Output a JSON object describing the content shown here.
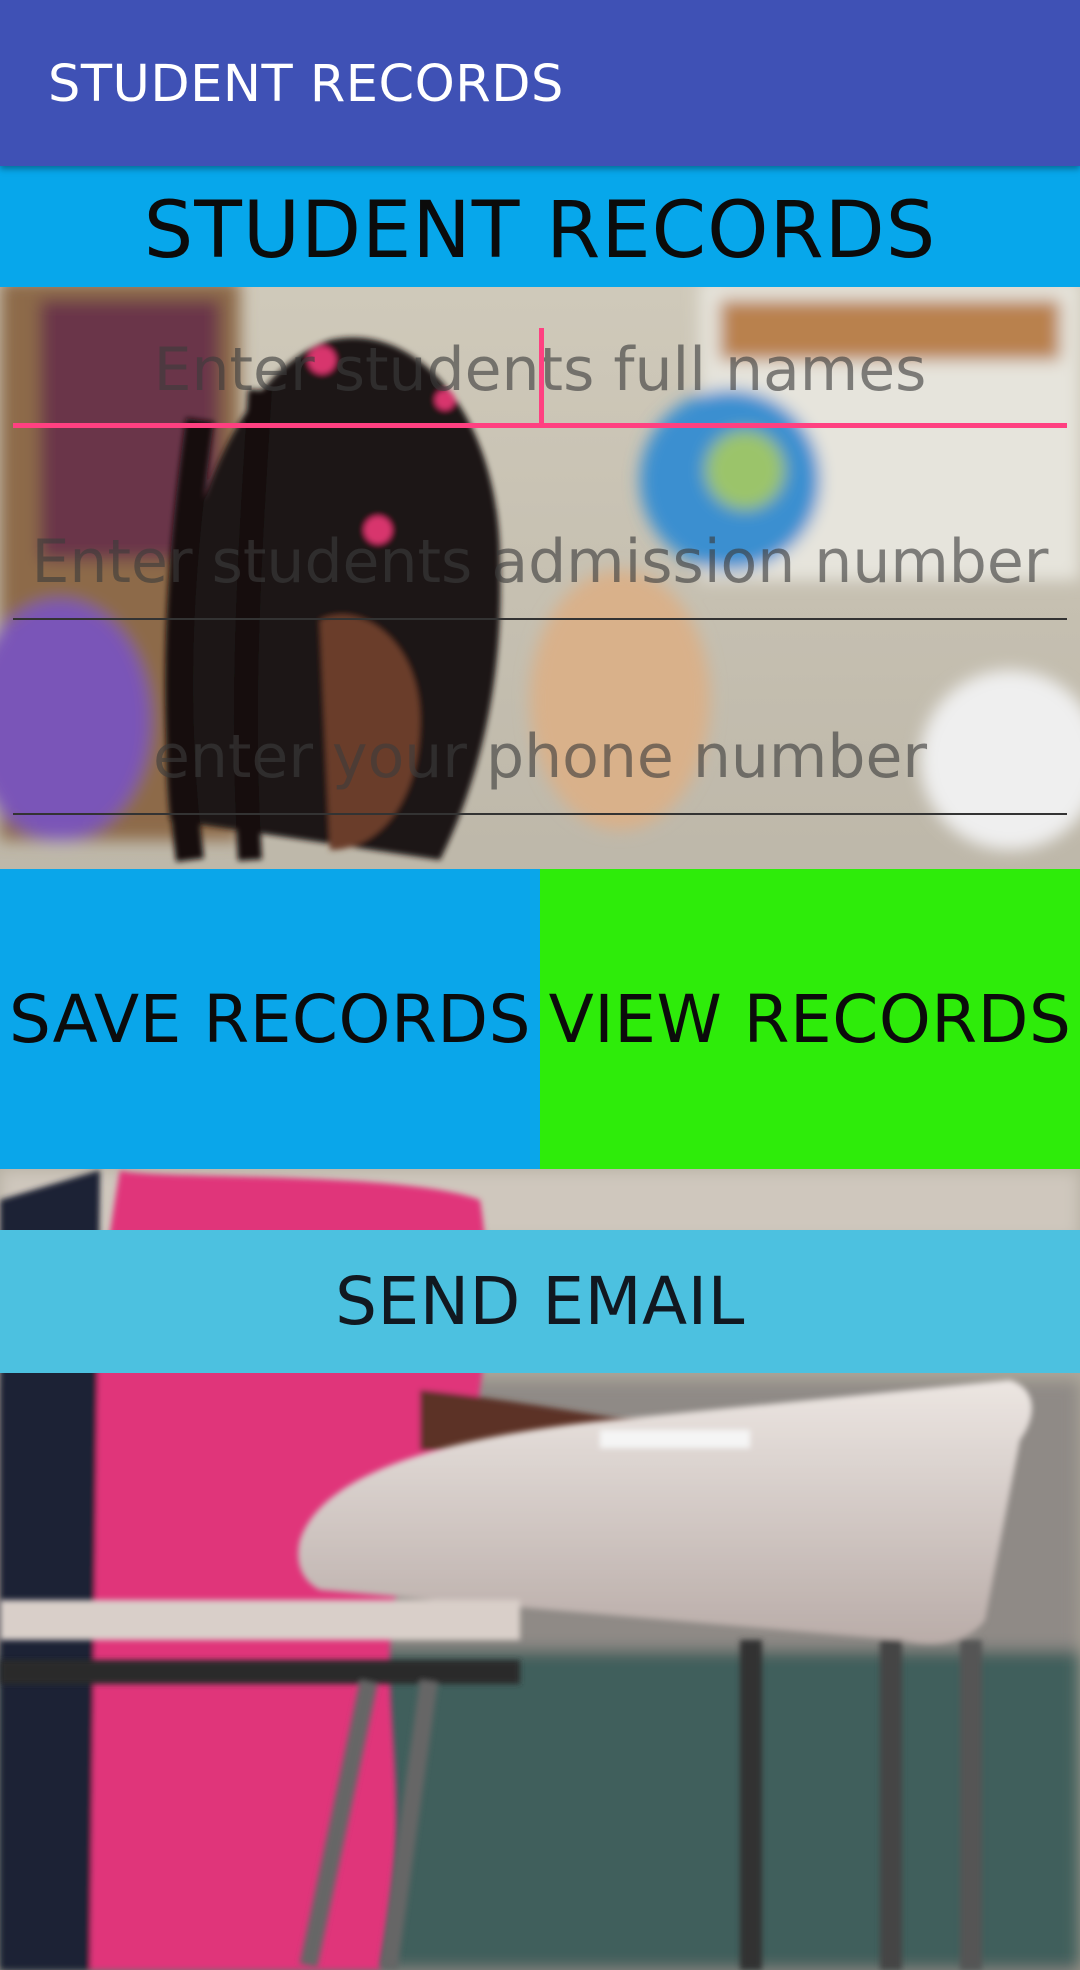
{
  "app_bar": {
    "title": "STUDENT RECORDS"
  },
  "banner": {
    "heading": "STUDENT RECORDS"
  },
  "form": {
    "full_name": {
      "placeholder": "Enter students full names",
      "value": "",
      "focused": true
    },
    "admission_number": {
      "placeholder": "Enter students admission number",
      "value": ""
    },
    "phone_number": {
      "placeholder": "enter your phone number",
      "value": ""
    }
  },
  "actions": {
    "save_label": "SAVE RECORDS",
    "view_label": "VIEW RECORDS",
    "email_label": "SEND EMAIL"
  },
  "colors": {
    "app_bar": "#3f51b5",
    "banner": "#07a7eb",
    "save_button": "#0aa6ea",
    "view_button": "#2eec0a",
    "email_button": "#4cc1e0",
    "focus_accent": "#ff4081"
  },
  "background": {
    "description_icon": "classroom-photo"
  }
}
